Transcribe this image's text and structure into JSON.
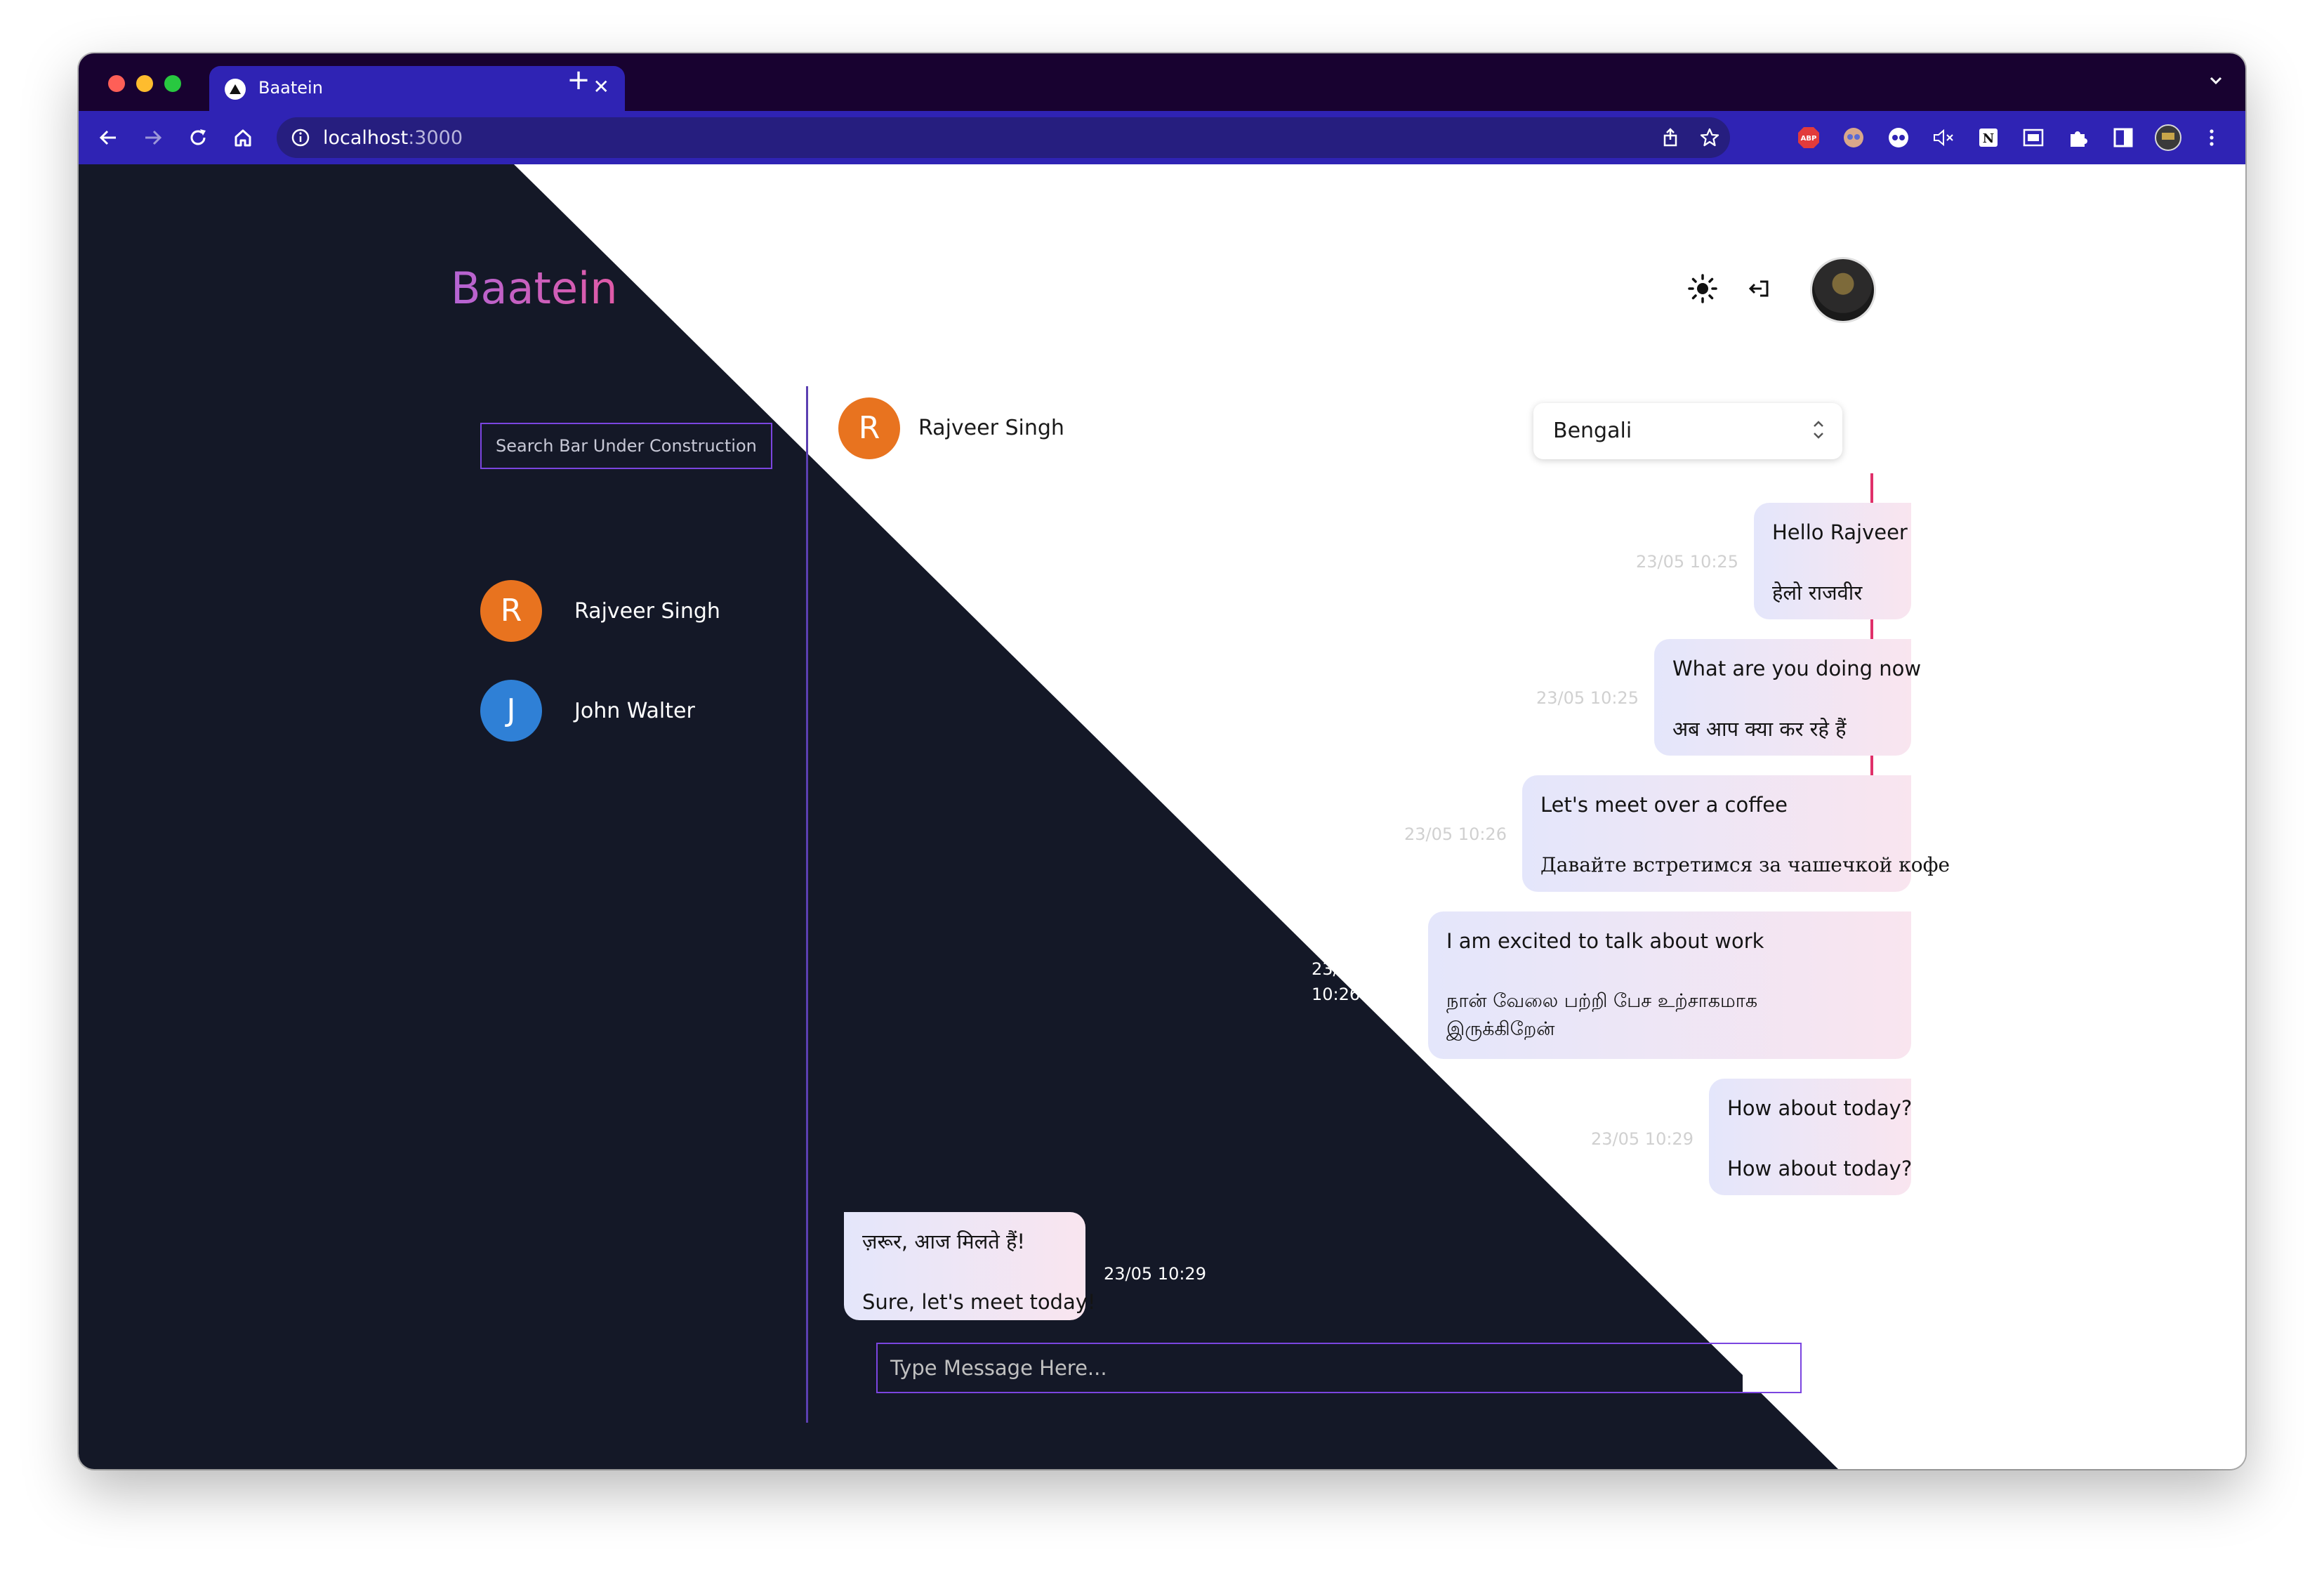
{
  "browser": {
    "tab_title": "Baatein",
    "tab_close": "✕",
    "new_tab": "+",
    "url_host": "localhost",
    "url_port": ":3000",
    "tabstrip_color": "#180230",
    "toolbar_color": "#2f23b4"
  },
  "app": {
    "logo": "Baatein",
    "search_placeholder": "Search Bar Under Construction",
    "message_placeholder": "Type Message Here..."
  },
  "contacts": [
    {
      "initial": "R",
      "name": "Rajveer Singh",
      "color": "#e8731f"
    },
    {
      "initial": "J",
      "name": "John Walter",
      "color": "#2f80d6"
    }
  ],
  "chat": {
    "header_initial": "R",
    "header_name": "Rajveer Singh",
    "language": "Bengali",
    "messages": [
      {
        "direction": "out",
        "text": "Hello Rajveer",
        "translation": "हेलो राजवीर",
        "timestamp": "23/05 10:25"
      },
      {
        "direction": "out",
        "text": "What are you doing now",
        "translation": "अब आप क्या कर रहे हैं",
        "timestamp": "23/05 10:25"
      },
      {
        "direction": "out",
        "text": "Let's meet over a coffee",
        "translation": "Давайте встретимся за чашечкой кофе",
        "timestamp": "23/05 10:26"
      },
      {
        "direction": "out",
        "text": "I am excited to talk about work",
        "translation_line1": "நான் வேலை பற்றி பேச உற்சாகமாக",
        "translation_line2": "இருக்கிறேன்",
        "timestamp_line1": "23/05",
        "timestamp_line2": "10:26"
      },
      {
        "direction": "out",
        "text": "How about today?",
        "translation": "How about today?",
        "timestamp": "23/05 10:29"
      },
      {
        "direction": "in",
        "text": "ज़रूर, आज मिलते हैं!",
        "translation": "Sure, let's meet today!",
        "timestamp": "23/05 10:29"
      }
    ]
  },
  "colors": {
    "dark_background": "#141827",
    "accent_purple": "#7b45e0",
    "scroll_indicator": "#e0306a"
  }
}
